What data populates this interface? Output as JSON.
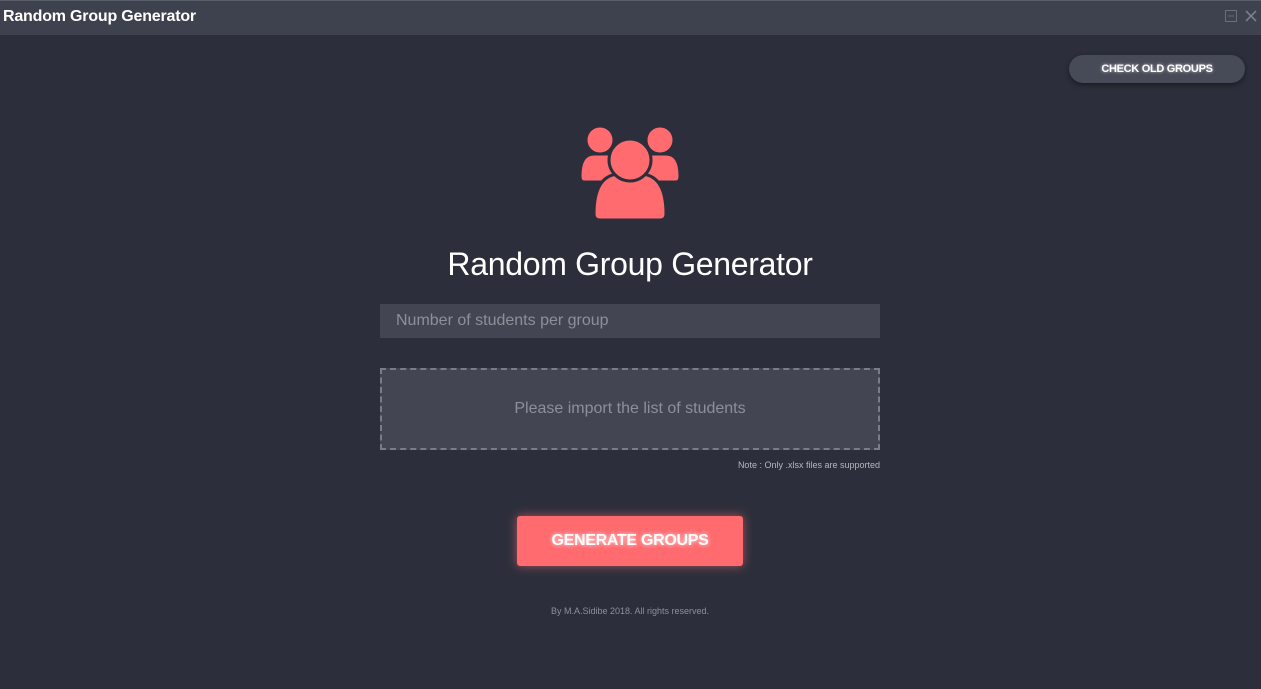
{
  "window": {
    "title": "Random Group Generator"
  },
  "header": {
    "check_old_groups_label": "CHECK OLD GROUPS"
  },
  "logo": {
    "icon": "users-group-icon",
    "color": "#ff6b6f"
  },
  "main": {
    "title": "Random Group Generator",
    "students_per_group": {
      "value": "",
      "placeholder": "Number of students per group"
    },
    "import": {
      "label": "Please import the list of students"
    },
    "note": "Note : Only .xlsx files are supported",
    "generate_label": "GENERATE GROUPS"
  },
  "footer": {
    "text": "By M.A.Sidibe 2018. All rights reserved."
  },
  "colors": {
    "background": "#2c2f3b",
    "titlebar": "#3e414e",
    "accent": "#ff6b6f",
    "input_bg": "#434552"
  }
}
